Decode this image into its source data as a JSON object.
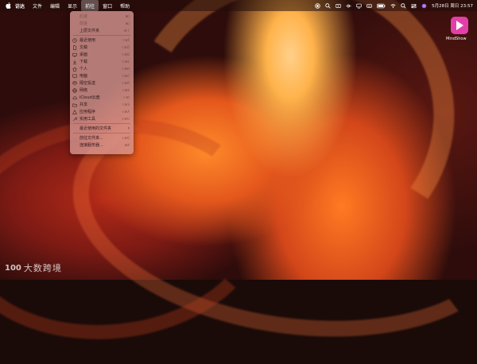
{
  "menubar": {
    "app_name": "访达",
    "items": [
      "文件",
      "编辑",
      "显示",
      "前往",
      "窗口",
      "帮助"
    ],
    "active_item": "前往",
    "datetime": "5月28日 周日 23:57"
  },
  "go_menu": {
    "items": [
      {
        "label": "后退",
        "shortcut": "⌘[",
        "icon": "",
        "disabled": true
      },
      {
        "label": "前进",
        "shortcut": "⌘]",
        "icon": "",
        "disabled": true
      },
      {
        "label": "上层文件夹",
        "shortcut": "⌘↑",
        "icon": "",
        "disabled": false
      },
      {
        "label": "最近使用",
        "shortcut": "⇧⌘F",
        "icon": "clock-icon",
        "disabled": false
      },
      {
        "label": "文稿",
        "shortcut": "⇧⌘O",
        "icon": "document-icon",
        "disabled": false
      },
      {
        "label": "桌面",
        "shortcut": "⇧⌘D",
        "icon": "desktop-icon",
        "disabled": false
      },
      {
        "label": "下载",
        "shortcut": "⌥⌘L",
        "icon": "download-icon",
        "disabled": false
      },
      {
        "label": "个人",
        "shortcut": "⇧⌘H",
        "icon": "home-icon",
        "disabled": false
      },
      {
        "label": "电脑",
        "shortcut": "⇧⌘C",
        "icon": "computer-icon",
        "disabled": false
      },
      {
        "label": "隔空投送",
        "shortcut": "⇧⌘R",
        "icon": "airdrop-icon",
        "disabled": false
      },
      {
        "label": "网络",
        "shortcut": "⇧⌘K",
        "icon": "network-icon",
        "disabled": false
      },
      {
        "label": "iCloud云盘",
        "shortcut": "⇧⌘I",
        "icon": "cloud-icon",
        "disabled": false
      },
      {
        "label": "共享",
        "shortcut": "⇧⌘S",
        "icon": "shared-folder-icon",
        "disabled": false
      },
      {
        "label": "应用程序",
        "shortcut": "⇧⌘A",
        "icon": "applications-icon",
        "disabled": false
      },
      {
        "label": "实用工具",
        "shortcut": "⇧⌘U",
        "icon": "utilities-icon",
        "disabled": false
      },
      {
        "label": "最近使用的文件夹",
        "shortcut": "",
        "icon": "",
        "disabled": false,
        "submenu": true
      },
      {
        "label": "前往文件夹...",
        "shortcut": "⇧⌘G",
        "icon": "",
        "disabled": false
      },
      {
        "label": "连接服务器...",
        "shortcut": "⌘K",
        "icon": "",
        "disabled": false
      }
    ]
  },
  "desktop": {
    "app_icon_label": "MindShow",
    "app_icon_color": "#e23fa8"
  },
  "watermark": {
    "text": "大数跨境",
    "logo": "100"
  }
}
